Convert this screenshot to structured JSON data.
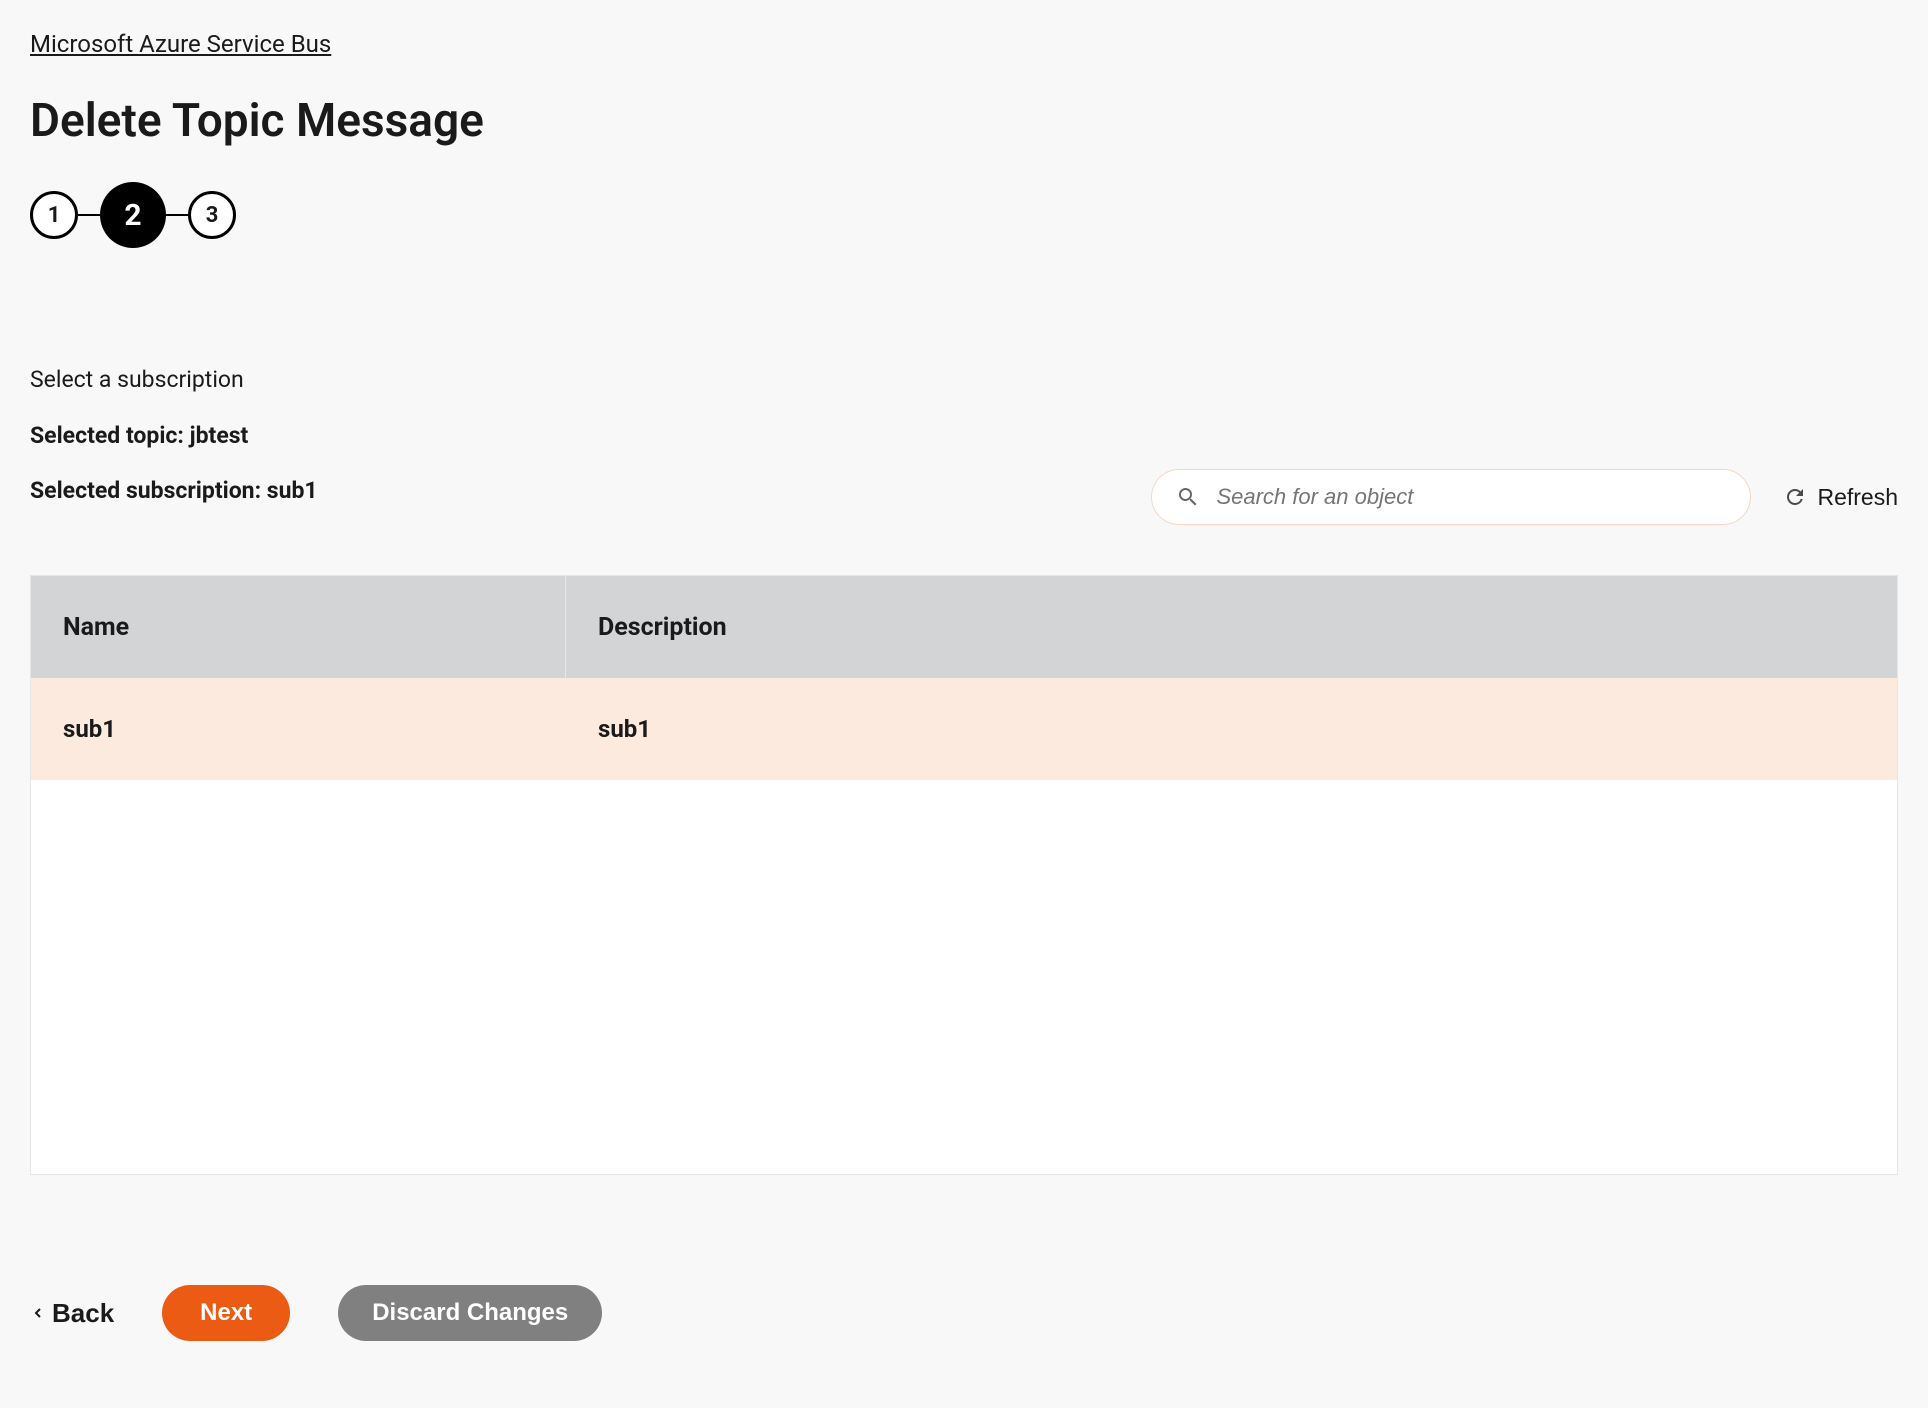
{
  "breadcrumb": {
    "label": "Microsoft Azure Service Bus"
  },
  "page": {
    "title": "Delete Topic Message"
  },
  "stepper": {
    "steps": [
      "1",
      "2",
      "3"
    ],
    "active_index": 1
  },
  "info": {
    "instruction": "Select a subscription",
    "selected_topic_label": "Selected topic: jbtest",
    "selected_subscription_label": "Selected subscription: sub1"
  },
  "search": {
    "placeholder": "Search for an object",
    "value": ""
  },
  "refresh": {
    "label": "Refresh"
  },
  "table": {
    "headers": {
      "name": "Name",
      "description": "Description"
    },
    "rows": [
      {
        "name": "sub1",
        "description": "sub1"
      }
    ]
  },
  "footer": {
    "back": "Back",
    "next": "Next",
    "discard": "Discard Changes"
  }
}
